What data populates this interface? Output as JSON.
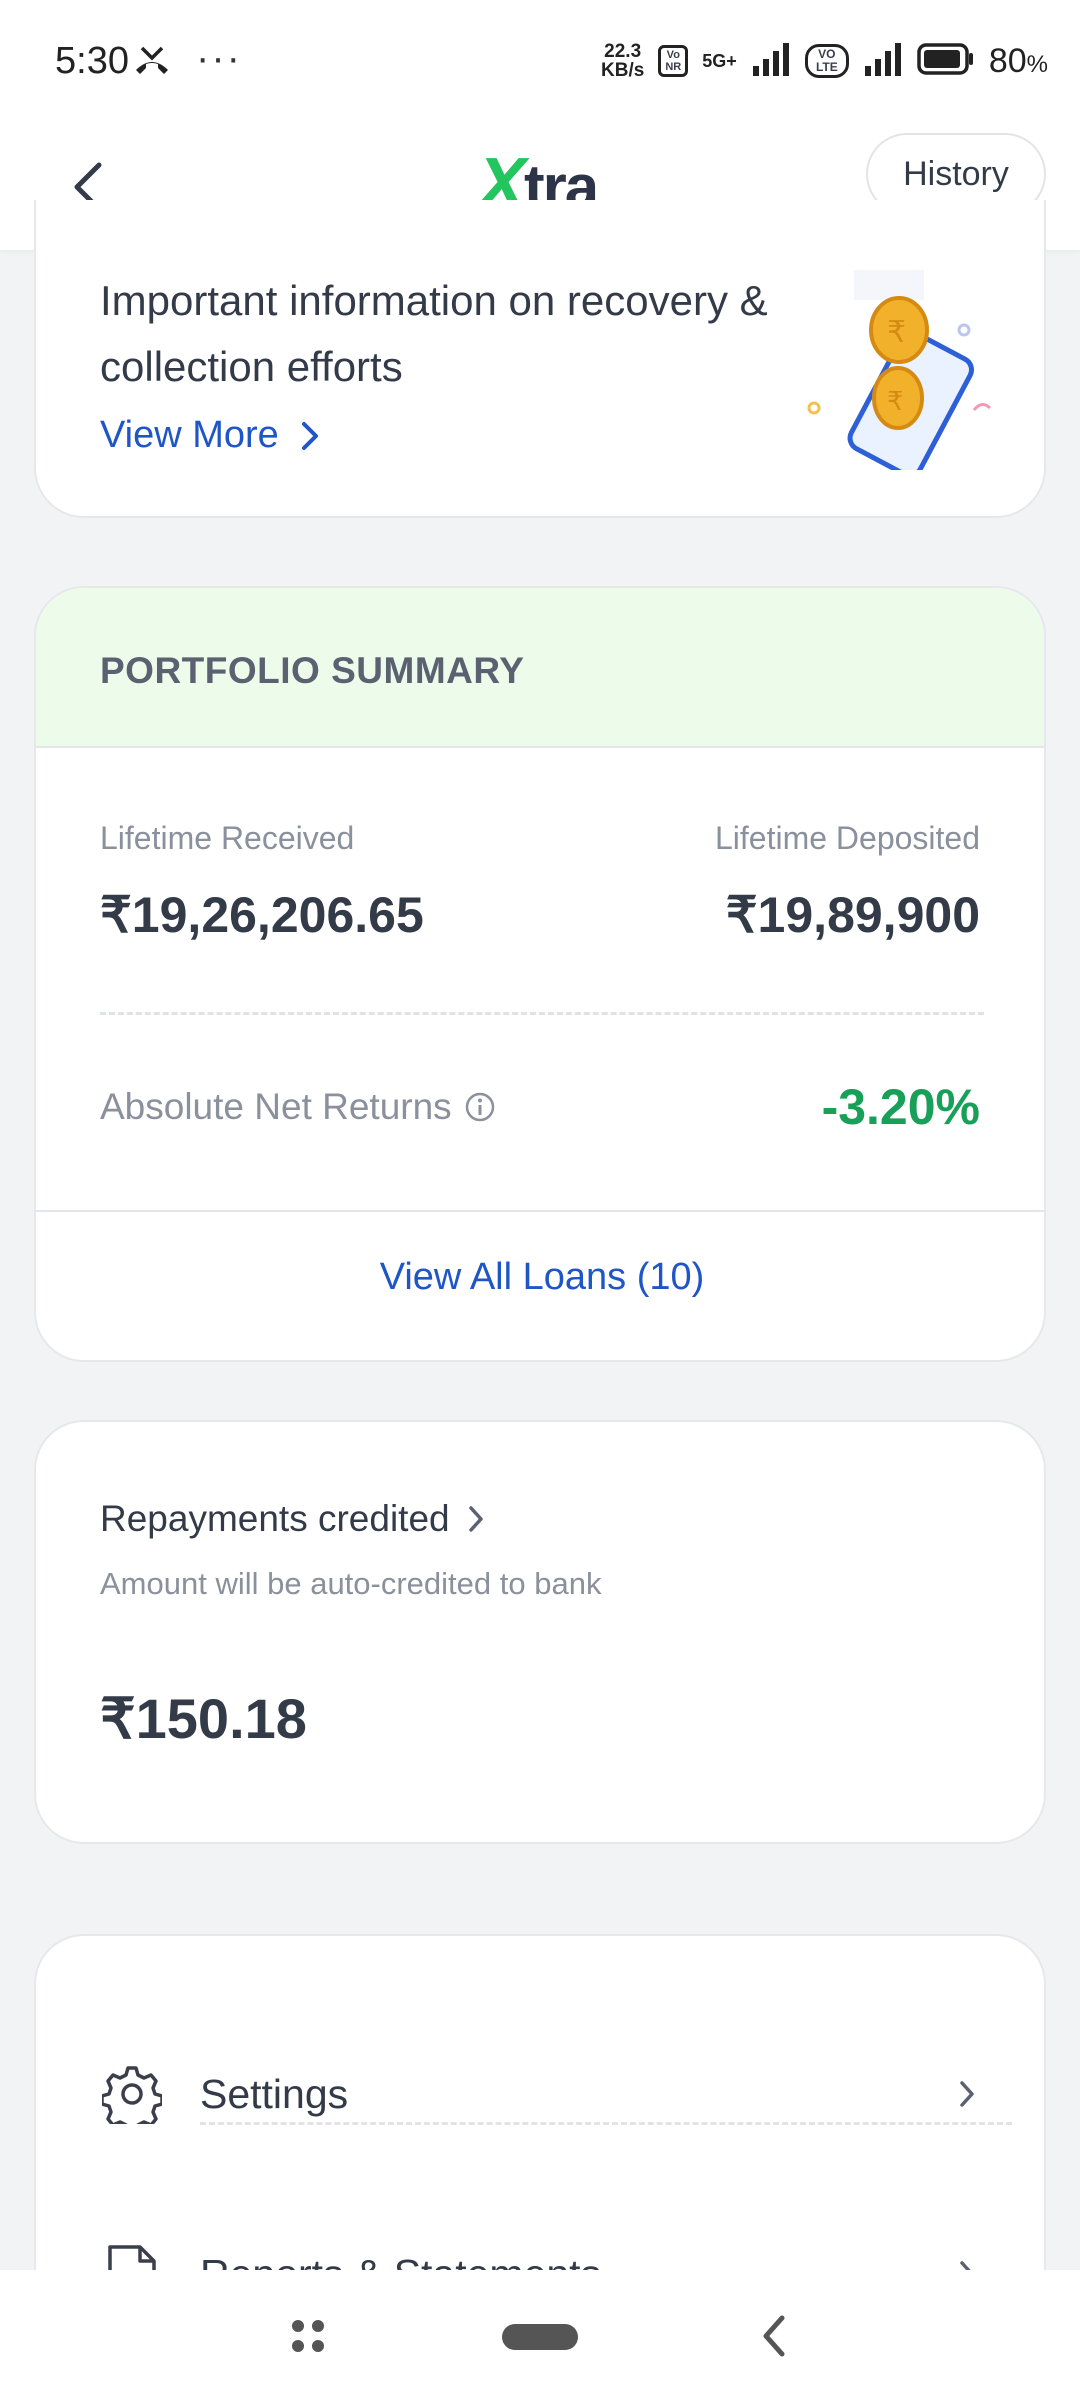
{
  "status_bar": {
    "time": "5:30",
    "more_indicator": "···",
    "net_speed_value": "22.3",
    "net_speed_unit": "KB/s",
    "vonr_badge": "Vo NR",
    "network_5g": "5G+",
    "volte_badge": "VO LTE",
    "battery_percent": "80",
    "battery_symbol": "%"
  },
  "header": {
    "logo_x": "X",
    "logo_rest": "tra",
    "history_label": "History"
  },
  "info_card": {
    "title": "Important information on recovery & collection efforts",
    "view_more_label": "View More"
  },
  "portfolio": {
    "title": "PORTFOLIO SUMMARY",
    "lifetime_received_label": "Lifetime Received",
    "lifetime_received_value": "₹19,26,206.65",
    "lifetime_deposited_label": "Lifetime Deposited",
    "lifetime_deposited_value": "₹19,89,900",
    "net_returns_label": "Absolute Net Returns",
    "net_returns_value": "-3.20%",
    "view_all_loans_label": "View All Loans (10)"
  },
  "repayments": {
    "title": "Repayments credited",
    "subtitle": "Amount will be auto-credited to bank",
    "amount": "₹150.18"
  },
  "menu": {
    "items": [
      {
        "label": "Settings",
        "icon": "gear-icon"
      },
      {
        "label": "Reports & Statements",
        "icon": "document-icon"
      }
    ]
  },
  "colors": {
    "accent_blue": "#1f56c7",
    "positive_green": "#18a058",
    "logo_green": "#22c55e",
    "summary_header_bg": "#edfbea"
  }
}
